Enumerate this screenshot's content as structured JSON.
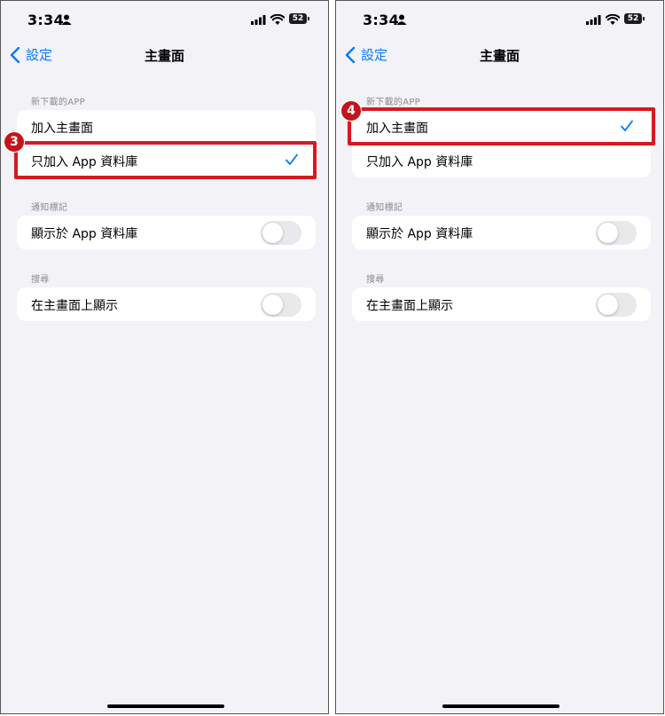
{
  "status": {
    "time": "3:34",
    "battery": "52"
  },
  "nav": {
    "back_label": "設定",
    "title": "主畫面"
  },
  "sections": {
    "new_apps": {
      "header": "新下載的APP",
      "options": [
        "加入主畫面",
        "只加入 App 資料庫"
      ]
    },
    "badges": {
      "header": "通知標記",
      "toggle_label": "顯示於 App 資料庫"
    },
    "search": {
      "header": "搜尋",
      "toggle_label": "在主畫面上顯示"
    }
  },
  "left_panel": {
    "step": "3",
    "selected_option": "只加入 App 資料庫"
  },
  "right_panel": {
    "step": "4",
    "selected_option": "加入主畫面"
  },
  "colors": {
    "accent": "#007aff",
    "highlight": "#d7191f",
    "background": "#f2f2f7"
  },
  "icons": [
    "person-icon",
    "signal-icon",
    "wifi-icon",
    "battery-icon",
    "chevron-left-icon",
    "checkmark-icon"
  ]
}
